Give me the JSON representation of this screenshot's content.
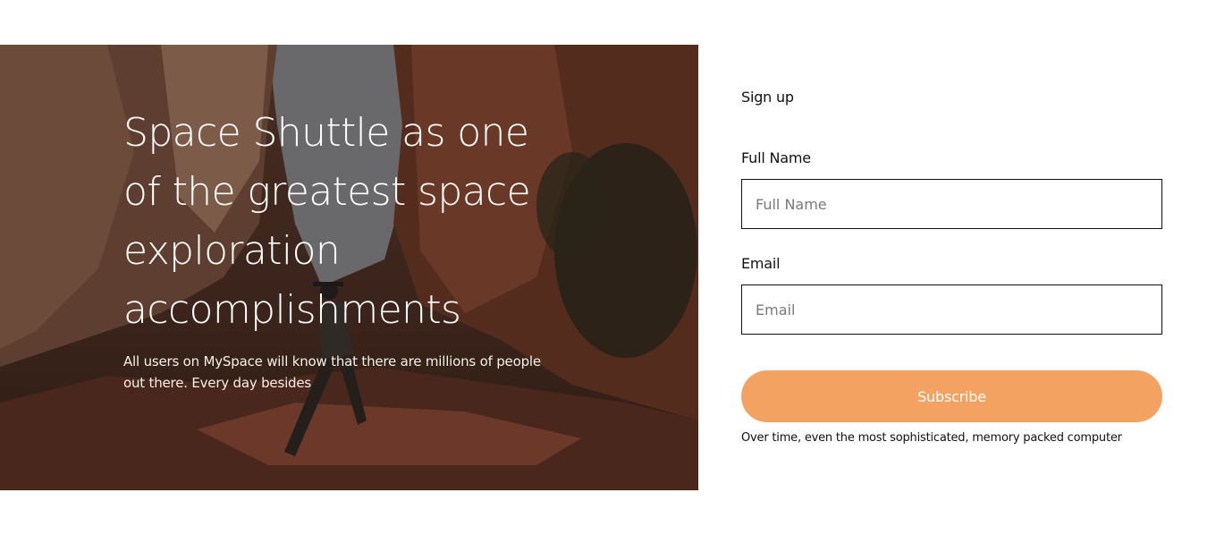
{
  "hero": {
    "title": "Space Shuttle as one of the greatest space exploration accomplishments",
    "description": "All users on MySpace will know that there are millions of people out there. Every day besides"
  },
  "form": {
    "heading": "Sign up",
    "full_name": {
      "label": "Full Name",
      "placeholder": "Full Name",
      "value": ""
    },
    "email": {
      "label": "Email",
      "placeholder": "Email",
      "value": ""
    },
    "subscribe_label": "Subscribe",
    "note": "Over time, even the most sophisticated, memory packed computer"
  },
  "colors": {
    "accent": "#f4a261",
    "border": "#111111"
  }
}
